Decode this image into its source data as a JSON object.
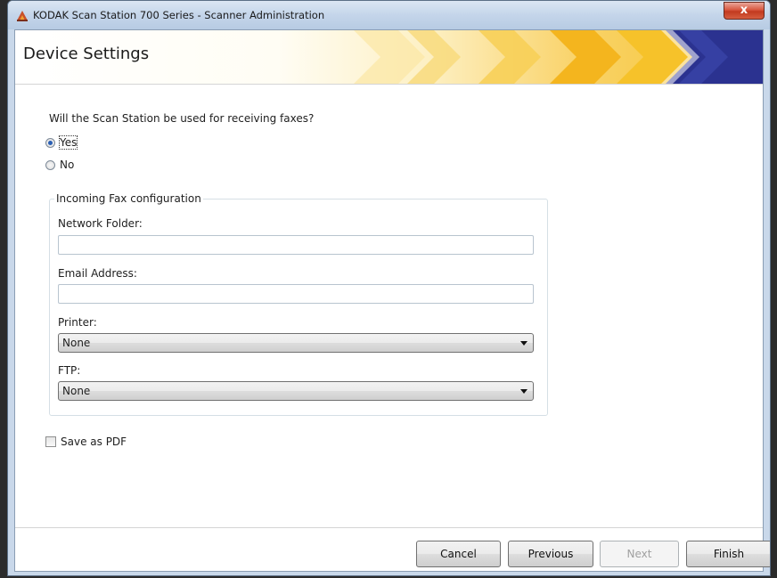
{
  "window": {
    "title": "KODAK Scan Station 700 Series - Scanner Administration",
    "close_glyph": "x"
  },
  "header": {
    "title": "Device Settings"
  },
  "form": {
    "question": "Will the Scan Station be used for receiving faxes?",
    "options": [
      {
        "label": "Yes",
        "selected": true
      },
      {
        "label": "No",
        "selected": false
      }
    ],
    "group": {
      "legend": "Incoming Fax configuration",
      "network_folder_label": "Network Folder:",
      "network_folder_value": "",
      "email_label": "Email Address:",
      "email_value": "",
      "printer_label": "Printer:",
      "printer_value": "None",
      "ftp_label": "FTP:",
      "ftp_value": "None"
    },
    "save_pdf_label": "Save as PDF",
    "save_pdf_checked": false
  },
  "buttons": {
    "cancel": "Cancel",
    "previous": "Previous",
    "next": "Next",
    "finish": "Finish"
  },
  "colors": {
    "header_accent_yellow": "#f6c22a",
    "header_accent_navy": "#2b3290",
    "titlebar": "#c4d5ea"
  }
}
